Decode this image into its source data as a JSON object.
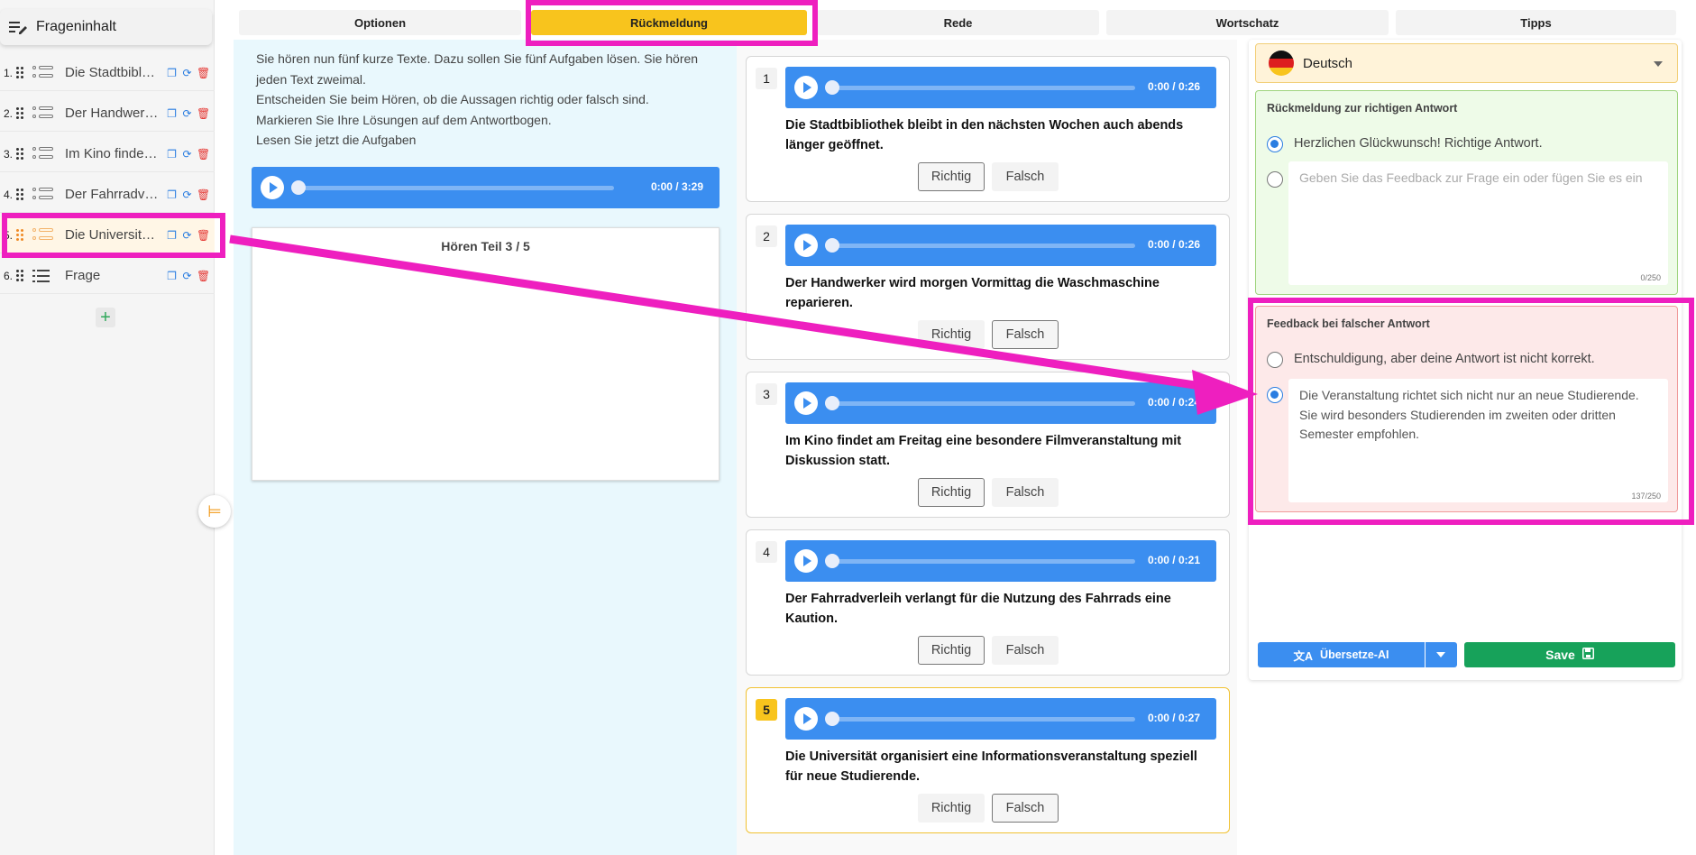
{
  "sidebar": {
    "header": "Frageninhalt",
    "items": [
      {
        "num": "1.",
        "label": "Die Stadtbibl…"
      },
      {
        "num": "2.",
        "label": "Der Handwer…"
      },
      {
        "num": "3.",
        "label": "Im Kino finde…"
      },
      {
        "num": "4.",
        "label": "Der Fahrradv…"
      },
      {
        "num": "5.",
        "label": "Die Universit…"
      },
      {
        "num": "6.",
        "label": "Frage"
      }
    ],
    "add_label": "+"
  },
  "tabs": [
    "Optionen",
    "Rückmeldung",
    "Rede",
    "Wortschatz",
    "Tipps"
  ],
  "left": {
    "intro": "Sie hören nun fünf kurze Texte. Dazu sollen Sie fünf Aufgaben lösen. Sie hören jeden Text zweimal.\nEntscheiden Sie beim Hören, ob die Aussagen richtig oder falsch sind.\nMarkieren Sie Ihre Lösungen auf dem Antwortbogen.\nLesen Sie jetzt die Aufgaben",
    "audio_time": "0:00 / 3:29",
    "image_caption": "Hören Teil 3 / 5"
  },
  "questions": [
    {
      "num": "1",
      "time": "0:00 / 0:26",
      "text": "Die Stadtbibliothek bleibt in den nächsten Wochen auch abends länger geöffnet.",
      "true_label": "Richtig",
      "false_label": "Falsch",
      "selected": "true"
    },
    {
      "num": "2",
      "time": "0:00 / 0:26",
      "text": "Der Handwerker wird morgen Vormittag die Waschmaschine reparieren.",
      "true_label": "Richtig",
      "false_label": "Falsch",
      "selected": "false"
    },
    {
      "num": "3",
      "time": "0:00 / 0:24",
      "text": "Im Kino findet am Freitag eine besondere Filmveranstaltung mit Diskussion statt.",
      "true_label": "Richtig",
      "false_label": "Falsch",
      "selected": "true"
    },
    {
      "num": "4",
      "time": "0:00 / 0:21",
      "text": "Der Fahrradverleih verlangt für die Nutzung des Fahrrads eine Kaution.",
      "true_label": "Richtig",
      "false_label": "Falsch",
      "selected": "true"
    },
    {
      "num": "5",
      "time": "0:00 / 0:27",
      "text": "Die Universität organisiert eine Informationsveranstaltung speziell für neue Studierende.",
      "true_label": "Richtig",
      "false_label": "Falsch",
      "selected": "false"
    }
  ],
  "right": {
    "language": "Deutsch",
    "correct_title": "Rückmeldung zur richtigen Antwort",
    "correct_option": "Herzlichen Glückwunsch! Richtige Antwort.",
    "correct_placeholder": "Geben Sie das Feedback zur Frage ein oder fügen Sie es ein",
    "correct_count": "0/250",
    "wrong_title": "Feedback bei falscher Antwort",
    "wrong_option": "Entschuldigung, aber deine Antwort ist nicht korrekt.",
    "wrong_text": "Die Veranstaltung richtet sich nicht nur an neue Studierende. Sie wird besonders Studierenden im zweiten oder dritten Semester empfohlen.",
    "wrong_count": "137/250",
    "translate_label": "Übersetze-AI",
    "save_label": "Save"
  },
  "colors": {
    "accent_yellow": "#f8c41d",
    "audio_blue": "#3b8ef0",
    "save_green": "#17a25a",
    "highlight_magenta": "#ee1fbf"
  }
}
